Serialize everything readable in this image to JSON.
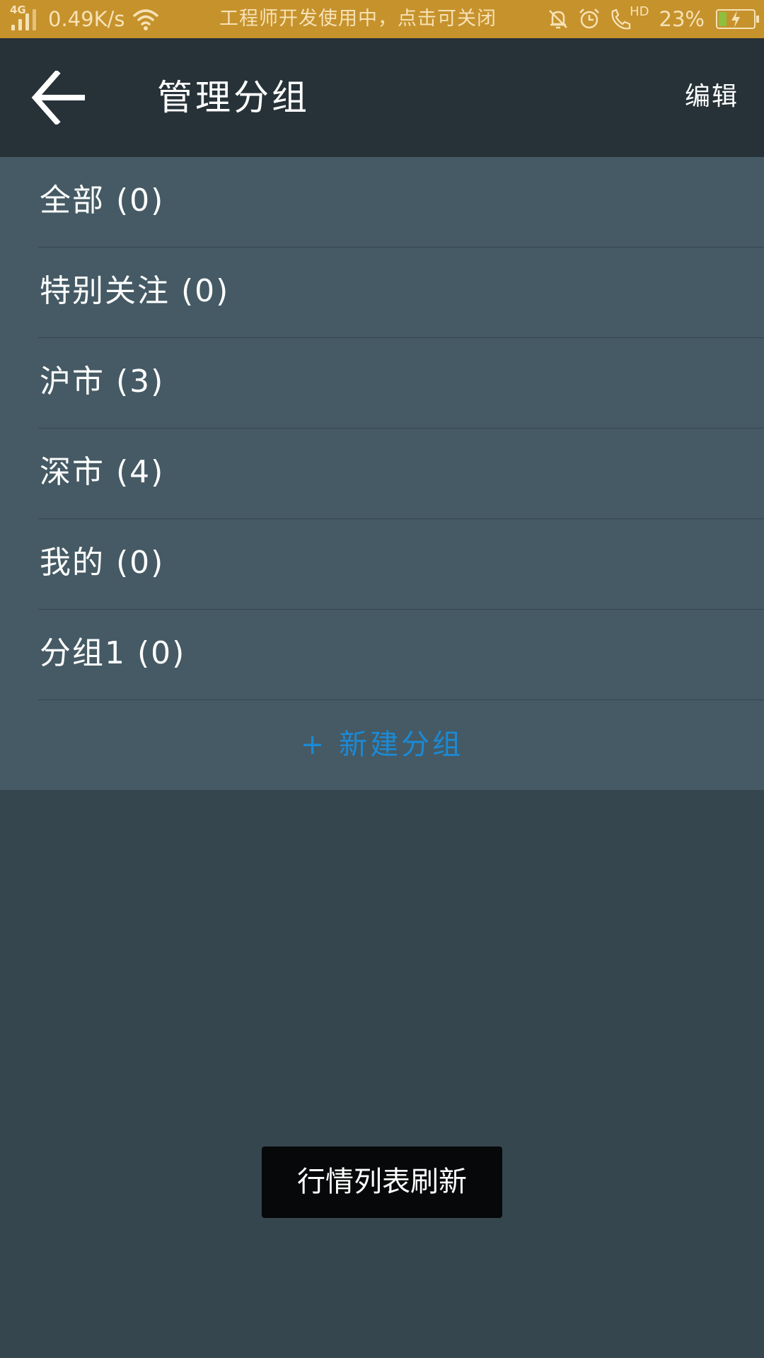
{
  "status_bar": {
    "network": "4G",
    "speed": "0.49K/s",
    "notice": "工程师开发使用中，点击可关闭",
    "hd_label": "HD",
    "battery_percent": "23%",
    "battery_level": 0.23,
    "icons": [
      "signal-icon",
      "wifi-icon",
      "bell-off-icon",
      "alarm-icon",
      "hd-call-icon",
      "battery-charging-icon"
    ]
  },
  "header": {
    "back_icon": "arrow-left-icon",
    "title": "管理分组",
    "edit_label": "编辑"
  },
  "groups": [
    {
      "label": "全部 (0)"
    },
    {
      "label": "特别关注 (0)"
    },
    {
      "label": "沪市 (3)"
    },
    {
      "label": "深市 (4)"
    },
    {
      "label": "我的 (0)"
    },
    {
      "label": "分组1 (0)"
    }
  ],
  "new_group_label": "+ 新建分组",
  "toast": "行情列表刷新",
  "colors": {
    "status_bar": "#c6922c",
    "app_bar": "#263238",
    "list_bg": "#455a64",
    "page_bg": "#36464f",
    "accent": "#1b8ad6",
    "toast_bg": "#060809"
  }
}
